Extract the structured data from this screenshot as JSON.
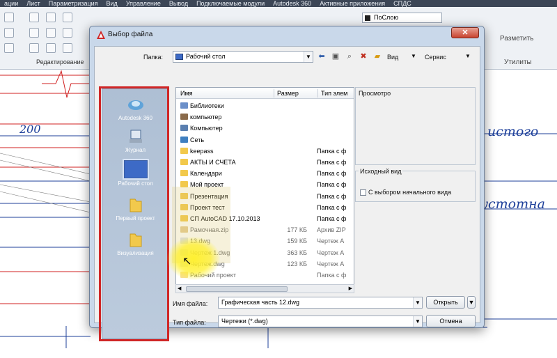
{
  "menubar": [
    "ации",
    "Лист",
    "Параметризация",
    "Вид",
    "Управление",
    "Вывод",
    "Подключаемые модули",
    "Autodesk 360",
    "Активные приложения",
    "СПДС"
  ],
  "ribbon": {
    "group_edit": "Редактирование",
    "layer_value": "ПоСлою",
    "measure_label": "Разметить",
    "utilities_label": "Утилиты"
  },
  "drawing": {
    "dim_200": "200",
    "text1": "истого",
    "text2": "устотна"
  },
  "dialog": {
    "title": "Выбор файла",
    "close_glyph": "✕",
    "folder_label": "Папка:",
    "folder_value": "Рабочий стол",
    "view_label": "Вид",
    "service_label": "Сервис",
    "preview_label": "Просмотро",
    "initial_view_label": "Исходный вид",
    "initial_view_checkbox": "С выбором начального вида",
    "filename_label": "Имя файла:",
    "filename_value": "Графическая часть 12.dwg",
    "filetype_label": "Тип файла:",
    "filetype_value": "Чертежи (*.dwg)",
    "open_button": "Открыть",
    "cancel_button": "Отмена"
  },
  "places": [
    {
      "label": "Autodesk 360",
      "icon": "cloud-icon"
    },
    {
      "label": "Журнал",
      "icon": "history-icon"
    },
    {
      "label": "Рабочий стол",
      "icon": "desktop-icon"
    },
    {
      "label": "Первый проект",
      "icon": "folder-icon"
    },
    {
      "label": "Визуализация",
      "icon": "folder-icon"
    }
  ],
  "columns": {
    "name": "Имя",
    "size": "Размер",
    "type": "Тип элем"
  },
  "files": [
    {
      "name": "Библиотеки",
      "size": "",
      "type": "",
      "icon": "libraries-icon"
    },
    {
      "name": "компьютер",
      "size": "",
      "type": "",
      "icon": "user-icon"
    },
    {
      "name": "Компьютер",
      "size": "",
      "type": "",
      "icon": "computer-icon"
    },
    {
      "name": "Сеть",
      "size": "",
      "type": "",
      "icon": "network-icon"
    },
    {
      "name": "keepass",
      "size": "",
      "type": "Папка с ф",
      "icon": "folder-icon"
    },
    {
      "name": "АКТЫ И СЧЕТА",
      "size": "",
      "type": "Папка с ф",
      "icon": "folder-icon"
    },
    {
      "name": "Календари",
      "size": "",
      "type": "Папка с ф",
      "icon": "folder-icon"
    },
    {
      "name": "Мой проект",
      "size": "",
      "type": "Папка с ф",
      "icon": "folder-icon"
    },
    {
      "name": "Презентация",
      "size": "",
      "type": "Папка с ф",
      "icon": "folder-icon"
    },
    {
      "name": "Проект тест",
      "size": "",
      "type": "Папка с ф",
      "icon": "folder-icon"
    },
    {
      "name": "СП AutoCAD 17.10.2013",
      "size": "",
      "type": "Папка с ф",
      "icon": "folder-icon"
    },
    {
      "name": "Рамочная.zip",
      "size": "177 КБ",
      "type": "Архив ZIP",
      "icon": "zip-icon"
    },
    {
      "name": "13.dwg",
      "size": "159 КБ",
      "type": "Чертеж А",
      "icon": "dwg-icon"
    },
    {
      "name": "Чертеж 1.dwg",
      "size": "363 КБ",
      "type": "Чертеж А",
      "icon": "dwg-icon"
    },
    {
      "name": "Чертеж.dwg",
      "size": "123 КБ",
      "type": "Чертеж А",
      "icon": "dwg-icon"
    },
    {
      "name": "Рабочий проект",
      "size": "",
      "type": "Папка с ф",
      "icon": "folder-icon"
    }
  ],
  "colors": {
    "highlight_red": "#d02626",
    "cad_blue": "#1d3f9a",
    "cad_red": "#d02020",
    "folder_yellow": "#f2c94c"
  }
}
